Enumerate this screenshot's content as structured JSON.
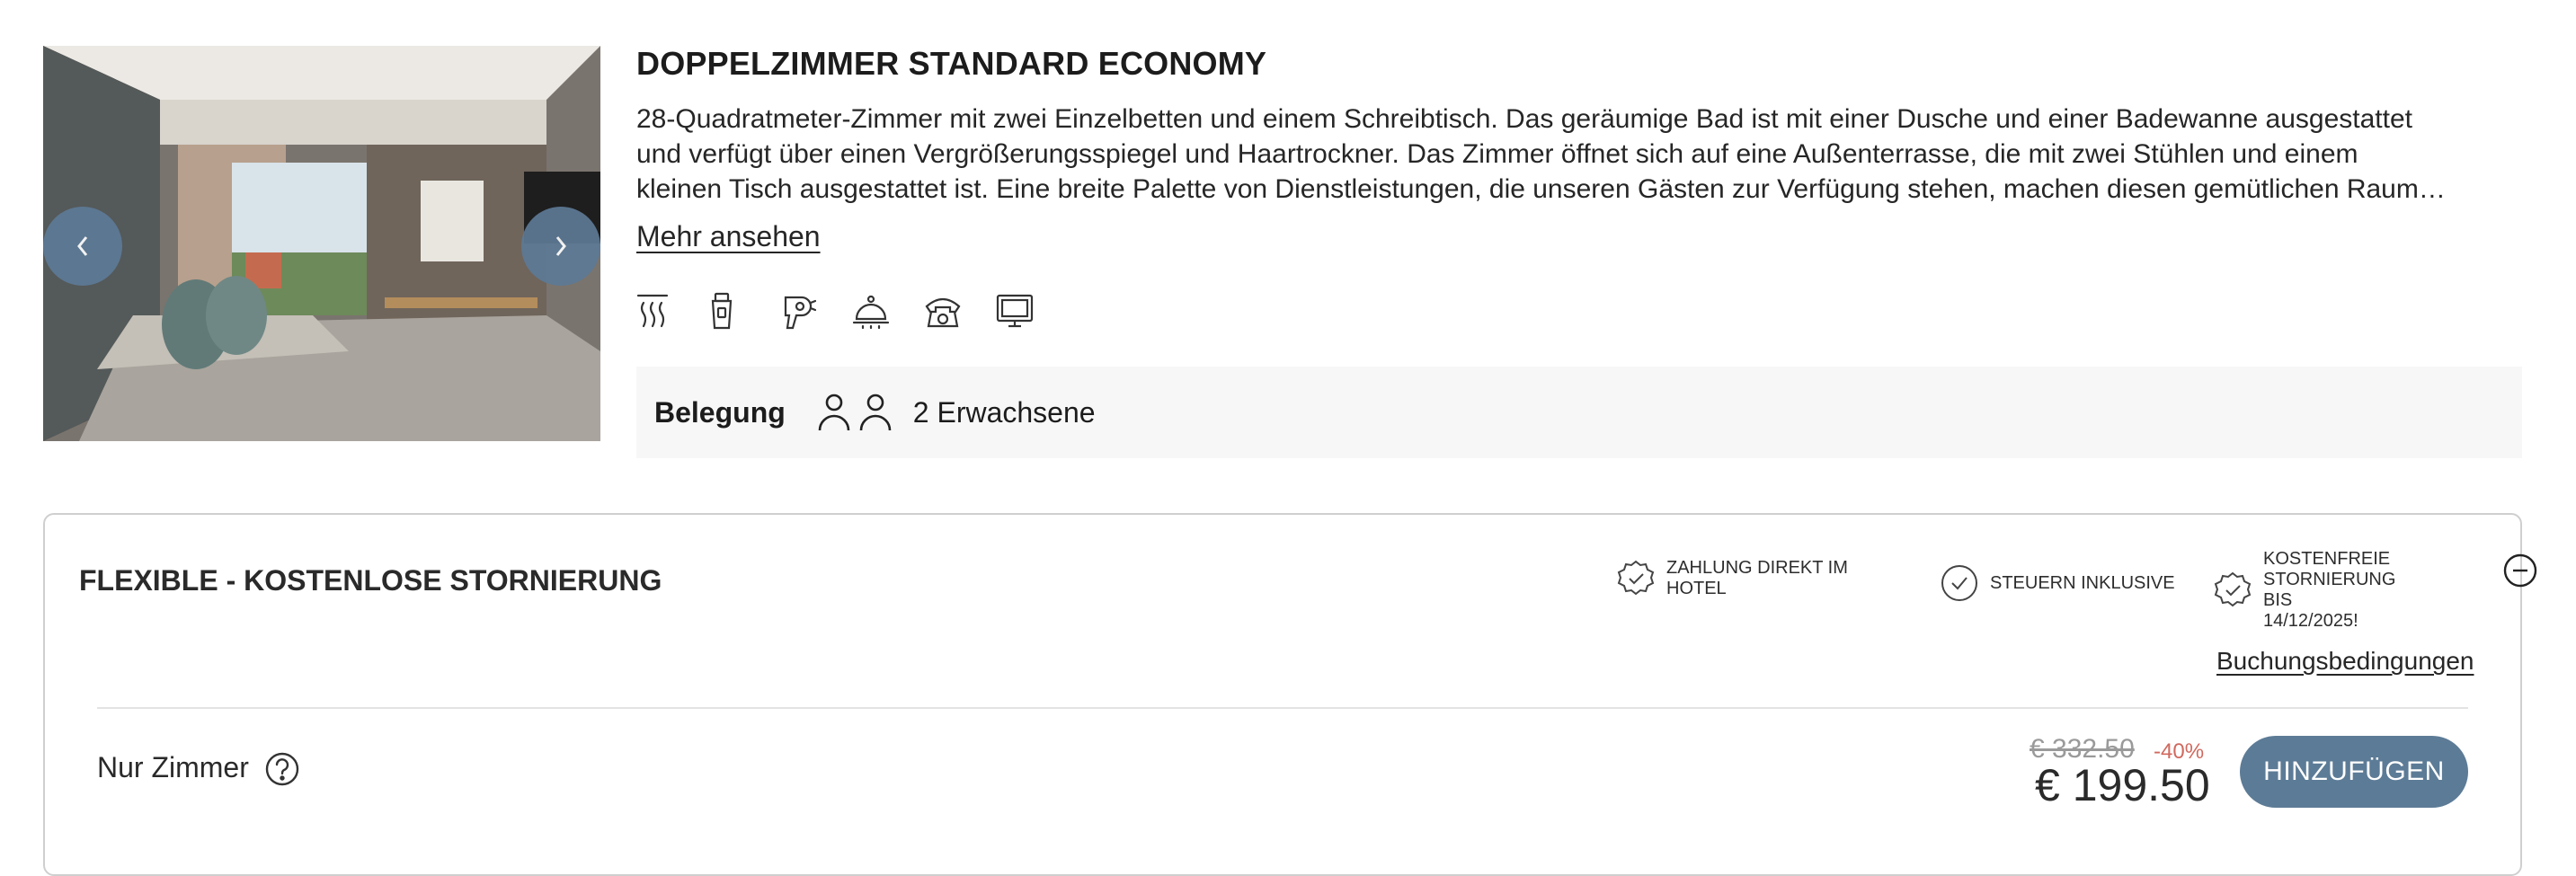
{
  "room": {
    "title": "DOPPELZIMMER STANDARD ECONOMY",
    "description_lines": [
      "28-Quadratmeter-Zimmer mit zwei Einzelbetten und einem Schreibtisch. Das geräumige Bad ist mit einer Dusche und einer Badewanne ausgestattet",
      "und verfügt über einen Vergrößerungsspiegel und Haartrockner. Das Zimmer öffnet sich auf eine Außenterrasse, die mit zwei Stühlen und einem",
      "kleinen Tisch ausgestattet ist. Eine breite Palette von Dienstleistungen, die unseren Gästen zur Verfügung stehen, machen diesen gemütlichen Raum…"
    ],
    "more_link": "Mehr ansehen",
    "amenity_icons": [
      "heating-icon",
      "toiletries-icon",
      "hairdryer-icon",
      "room-service-icon",
      "telephone-icon",
      "tv-icon"
    ],
    "occupancy": {
      "label": "Belegung",
      "value": "2 Erwachsene",
      "icons": [
        "adult-icon",
        "adult-icon"
      ]
    }
  },
  "rate": {
    "title": "FLEXIBLE - KOSTENLOSE STORNIERUNG",
    "features": [
      {
        "icon": "badge-check-icon",
        "lines": [
          "ZAHLUNG DIREKT IM",
          "HOTEL"
        ]
      },
      {
        "icon": "circle-check-icon",
        "lines": [
          "STEUERN INKLUSIVE"
        ]
      },
      {
        "icon": "badge-check-icon",
        "lines": [
          "KOSTENFREIE",
          "STORNIERUNG BIS",
          "14/12/2025!"
        ]
      }
    ],
    "terms_link": "Buchungsbedingungen",
    "option": {
      "label": "Nur Zimmer",
      "old_price": "€ 332.50",
      "discount": "-40%",
      "price": "€ 199.50",
      "add_button": "HINZUFÜGEN"
    }
  },
  "colors": {
    "accent": "#5c7b96",
    "discount": "#d0695e",
    "panel": "#f7f7f7"
  }
}
